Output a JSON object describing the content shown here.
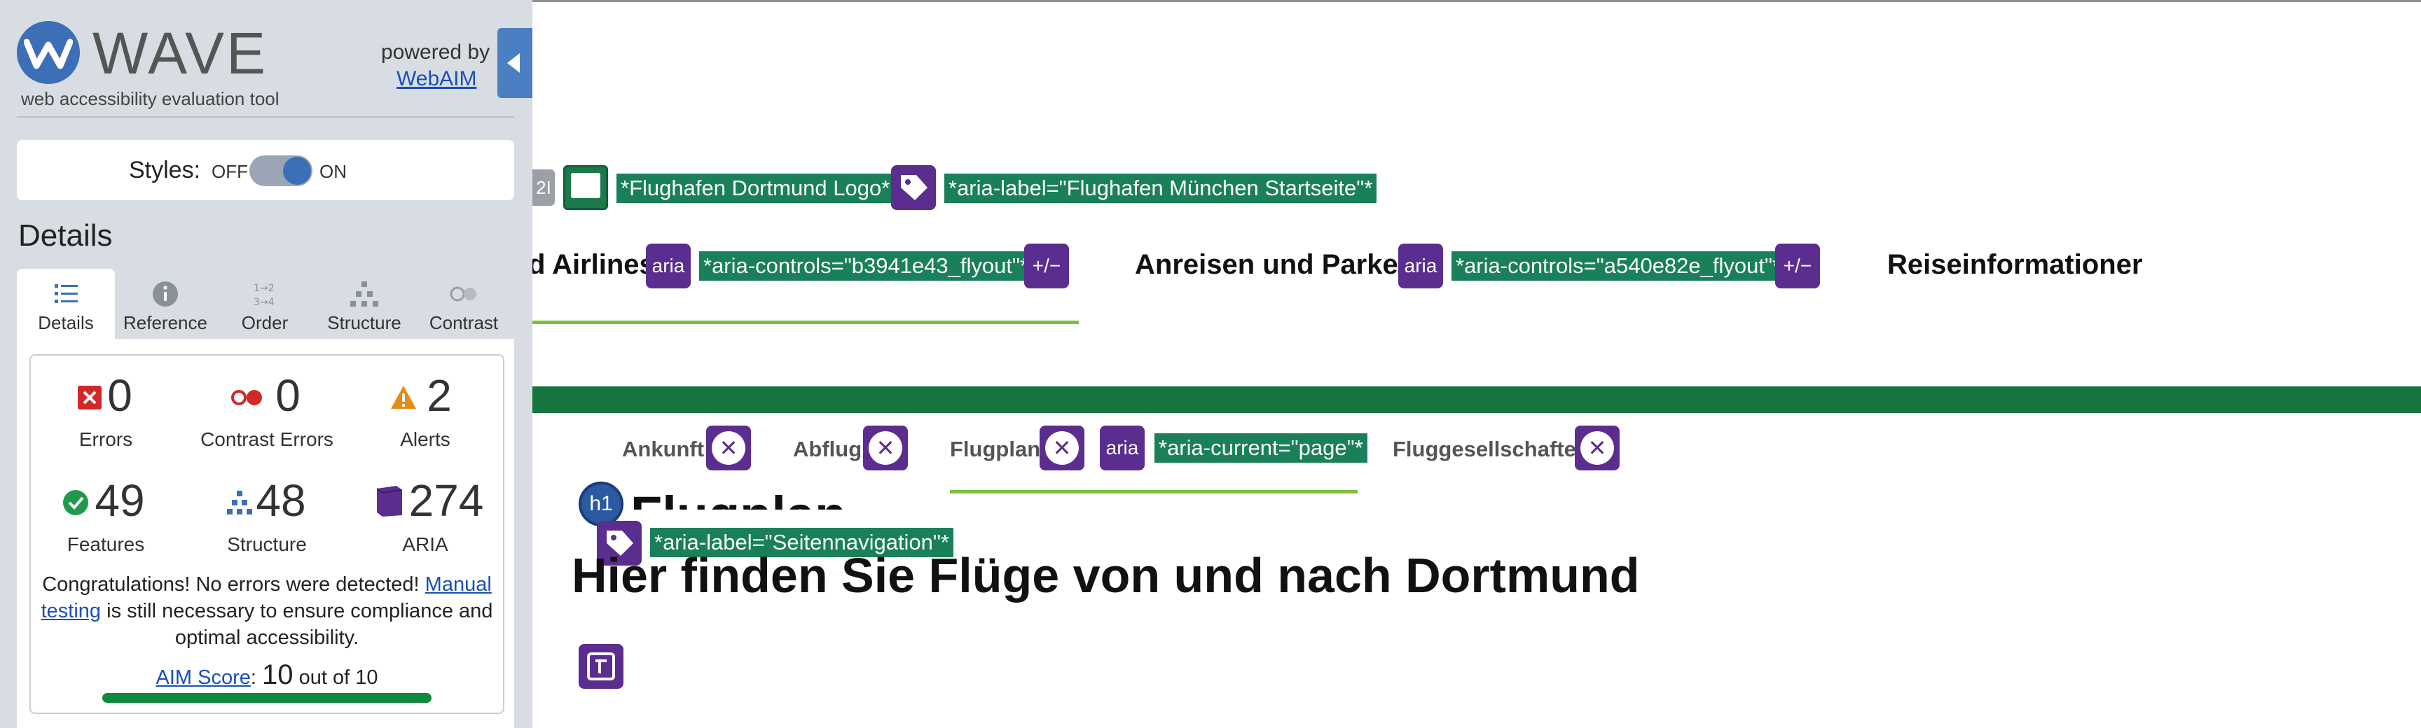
{
  "wave": {
    "title": "WAVE",
    "tagline": "web accessibility evaluation tool",
    "powered_by": "powered by",
    "webaim_link": "WebAIM",
    "styles_label": "Styles:",
    "styles_off": "OFF",
    "styles_on": "ON",
    "details_heading": "Details",
    "tabs": [
      {
        "label": "Details",
        "icon": "list-icon"
      },
      {
        "label": "Reference",
        "icon": "info-icon"
      },
      {
        "label": "Order",
        "icon": "order-icon"
      },
      {
        "label": "Structure",
        "icon": "structure-icon"
      },
      {
        "label": "Contrast",
        "icon": "contrast-icon"
      }
    ],
    "stats": {
      "errors": {
        "value": "0",
        "label": "Errors"
      },
      "contrast_errors": {
        "value": "0",
        "label": "Contrast Errors"
      },
      "alerts": {
        "value": "2",
        "label": "Alerts"
      },
      "features": {
        "value": "49",
        "label": "Features"
      },
      "structure": {
        "value": "48",
        "label": "Structure"
      },
      "aria": {
        "value": "274",
        "label": "ARIA"
      }
    },
    "congrats_1": "Congratulations! No errors were detected! ",
    "manual_testing": "Manual testing",
    "congrats_2": " is still necessary to ensure compliance and optimal accessibility.",
    "aim_link": "AIM Score",
    "aim_colon": ":",
    "aim_score": "10",
    "aim_out_of": "out of 10",
    "colors": {
      "primary": "#3d6fb6",
      "aria": "#5b2d8e",
      "tag": "#19805a",
      "error": "#d22828",
      "alert": "#e98a15",
      "feature": "#1f9a4c"
    }
  },
  "page": {
    "image_label": "*Flughafen Dortmund Logo*",
    "home_aria_label": "*aria-label=\"Flughafen München Startseite\"*",
    "nav_items": [
      {
        "label": "d Airlines",
        "aria_icon": "aria",
        "aria_controls": "*aria-controls=\"b3941e43_flyout\"*",
        "toggle": "+/−"
      },
      {
        "label": "Anreisen und Parken",
        "aria_icon": "aria",
        "aria_controls": "*aria-controls=\"a540e82e_flyout\"*",
        "toggle": "+/−"
      },
      {
        "label": "Reiseinformationer"
      }
    ],
    "sub_nav": [
      {
        "label": "Ankunft"
      },
      {
        "label": "Abflug"
      },
      {
        "label": "Flugplan",
        "aria_icon": "aria",
        "aria_current": "*aria-current=\"page\"*"
      },
      {
        "label": "Fluggesellschaften"
      }
    ],
    "h1_icon": "h1",
    "heading_partial": "Flugplan",
    "sub_nav_aria_label": "*aria-label=\"Seitennavigation\"*",
    "main_heading": "Hier finden Sie Flüge von und nach Dortmund",
    "x_icon_glyph": "✕",
    "grey_icon_glyph": "2I",
    "colors": {
      "nav_underline": "#7cc03a",
      "green_bar": "#14753f"
    }
  }
}
